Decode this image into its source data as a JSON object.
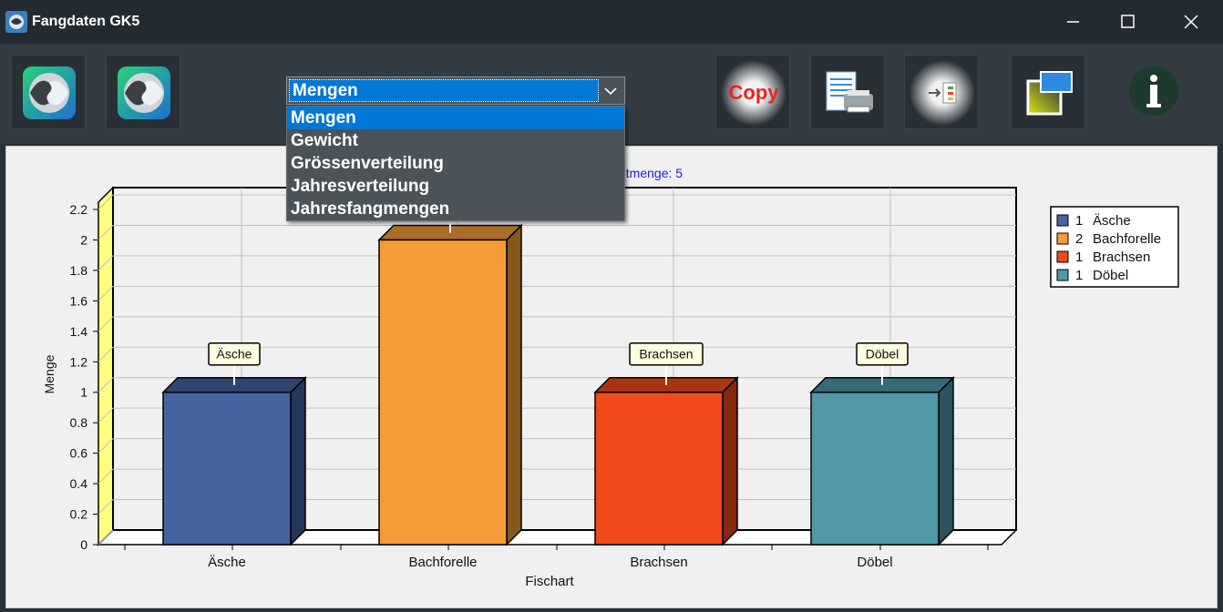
{
  "window": {
    "title": "Fangdaten GK5"
  },
  "colors": {
    "titlebar": "#232b31",
    "toolbar": "#323c42",
    "accent": "#0078d7",
    "copy_text": "#e8241c"
  },
  "toolbar": {
    "copy_label": "Copy",
    "buttons": [
      "fish-app-icon",
      "fish-app-icon-2",
      "copy-icon",
      "print-icon",
      "export-icon",
      "window-icon",
      "info-icon"
    ]
  },
  "combo": {
    "selected": "Mengen",
    "options": [
      "Mengen",
      "Gewicht",
      "Grössenverteilung",
      "Jahresverteilung",
      "Jahresfangmengen"
    ]
  },
  "chart_data": {
    "type": "bar",
    "title_visible": "ntmenge: 5",
    "categories": [
      "Äsche",
      "Bachforelle",
      "Brachsen",
      "Döbel"
    ],
    "values": [
      1,
      2,
      1,
      1
    ],
    "colors": [
      "#4463a0",
      "#f39c38",
      "#f04a18",
      "#4e98a8"
    ],
    "xlabel": "Fischart",
    "ylabel": "Menge",
    "ylim": [
      0,
      2.2
    ],
    "yticks": [
      "0",
      "0.2",
      "0.4",
      "0.6",
      "0.8",
      "1",
      "1.2",
      "1.4",
      "1.6",
      "1.8",
      "2",
      "2.2"
    ],
    "grid": true,
    "data_labels": [
      "Äsche",
      "Bachforelle",
      "Brachsen",
      "Döbel"
    ],
    "legend_position": "top-right",
    "legend": [
      {
        "count": "1",
        "name": "Äsche"
      },
      {
        "count": "2",
        "name": "Bachforelle"
      },
      {
        "count": "1",
        "name": "Brachsen"
      },
      {
        "count": "1",
        "name": "Döbel"
      }
    ]
  }
}
